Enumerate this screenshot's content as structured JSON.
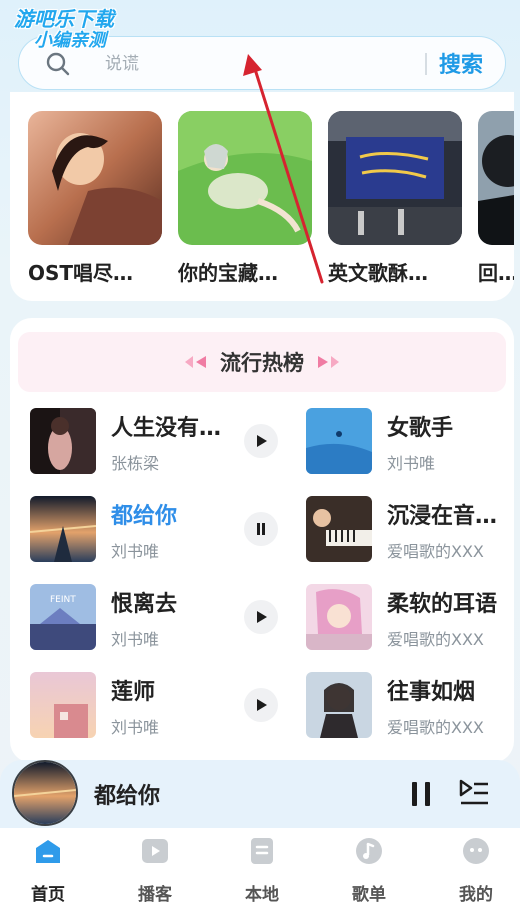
{
  "watermark": {
    "line1": "游吧乐下载",
    "line2": "小编亲测"
  },
  "search": {
    "placeholder": "说谎",
    "button_label": "搜索"
  },
  "playlists": [
    {
      "title": "OST唱尽…"
    },
    {
      "title": "你的宝藏…"
    },
    {
      "title": "英文歌酥…"
    },
    {
      "title": "回…"
    }
  ],
  "chart": {
    "title": "流行热榜",
    "songs": [
      {
        "title": "人生没有…",
        "artist": "张栋梁",
        "state": "play"
      },
      {
        "title": "女歌手",
        "artist": "刘书唯"
      },
      {
        "title": "都给你",
        "artist": "刘书唯",
        "state": "pause",
        "active": true
      },
      {
        "title": "沉浸在音…",
        "artist": "爱唱歌的XXX"
      },
      {
        "title": "恨离去",
        "artist": "刘书唯",
        "state": "play"
      },
      {
        "title": "柔软的耳语",
        "artist": "爱唱歌的XXX"
      },
      {
        "title": "莲师",
        "artist": "刘书唯",
        "state": "play"
      },
      {
        "title": "往事如烟",
        "artist": "爱唱歌的XXX"
      }
    ]
  },
  "player": {
    "title": "都给你",
    "state": "playing"
  },
  "tabs": [
    {
      "label": "首页",
      "icon": "home-icon",
      "active": true
    },
    {
      "label": "播客",
      "icon": "podcast-icon"
    },
    {
      "label": "本地",
      "icon": "local-music-icon"
    },
    {
      "label": "歌单",
      "icon": "playlist-note-icon"
    },
    {
      "label": "我的",
      "icon": "profile-face-icon"
    }
  ],
  "colors": {
    "accent": "#1f9ae6",
    "active_song": "#2f8ee8",
    "chart_header_bg": "#fdf0f5",
    "arrow": "#d62430"
  }
}
